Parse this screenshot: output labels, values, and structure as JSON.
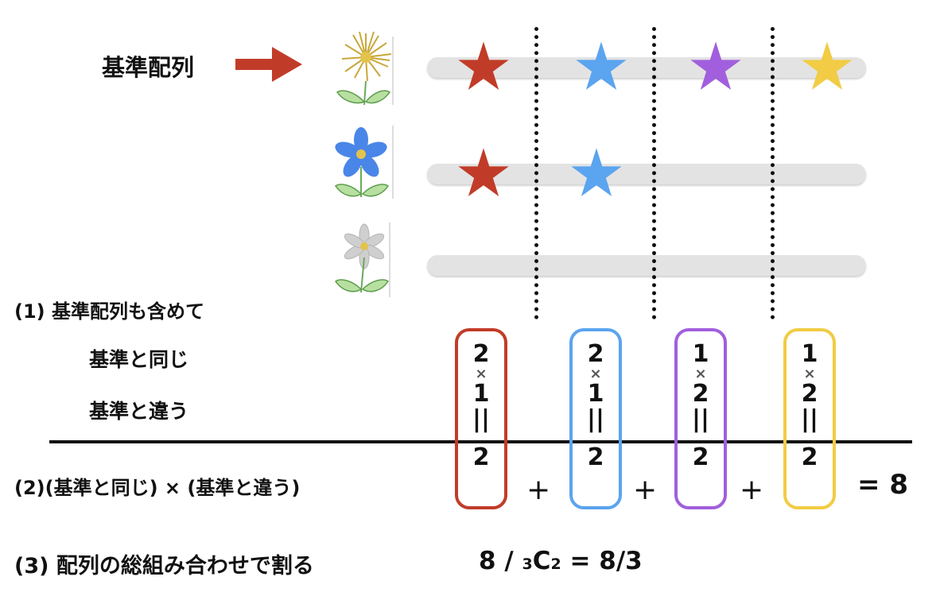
{
  "reference_label": "基準配列",
  "step1": {
    "title": "(1)  基準配列も含めて",
    "same_label": "基準と同じ",
    "diff_label": "基準と違う"
  },
  "step2": {
    "text": "(2)(基準と同じ) × (基準と違う)",
    "plus": "+",
    "total": "= 8"
  },
  "step3": {
    "text": "(3) 配列の総組み合わせで割る",
    "formula_pre": "8 / ",
    "formula_sub_left": "3",
    "formula_c": "C",
    "formula_sub_right": "2",
    "formula_post": " = 8/3"
  },
  "colors": {
    "red": "#c13c28",
    "blue": "#5ba4ef",
    "purple": "#a15fdd",
    "yellow": "#f1cc44"
  },
  "columns": [
    {
      "same": "2",
      "times": "×",
      "diff": "1",
      "equals": "||",
      "result": "2",
      "color": "#c13c28"
    },
    {
      "same": "2",
      "times": "×",
      "diff": "1",
      "equals": "||",
      "result": "2",
      "color": "#5ba4ef"
    },
    {
      "same": "1",
      "times": "×",
      "diff": "2",
      "equals": "||",
      "result": "2",
      "color": "#a15fdd"
    },
    {
      "same": "1",
      "times": "×",
      "diff": "2",
      "equals": "||",
      "result": "2",
      "color": "#f1cc44"
    }
  ],
  "icons": [
    "arrow-right-icon",
    "yellow-flower-icon",
    "blue-flower-icon",
    "white-flower-icon",
    "star-icon"
  ]
}
